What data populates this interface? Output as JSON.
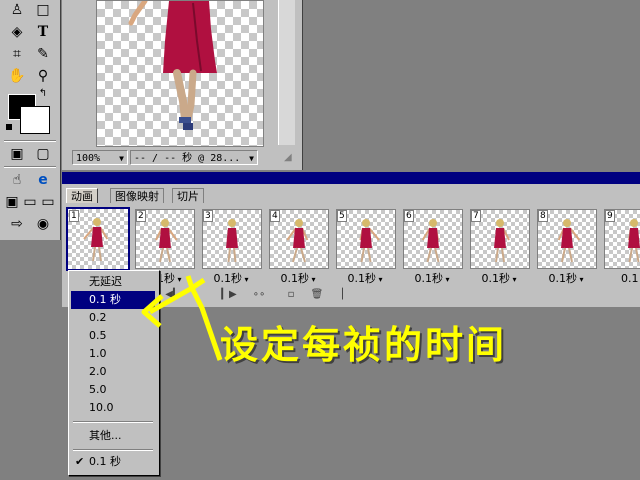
{
  "document": {
    "zoom": "100%",
    "timing_status": "-- / -- 秒 @ 28..."
  },
  "animation_palette": {
    "tabs": [
      "动画",
      "图像映射",
      "切片"
    ],
    "frames": [
      {
        "number": "1",
        "time": ""
      },
      {
        "number": "2",
        "time": "0.1秒"
      },
      {
        "number": "3",
        "time": "0.1秒"
      },
      {
        "number": "4",
        "time": "0.1秒"
      },
      {
        "number": "5",
        "time": "0.1秒"
      },
      {
        "number": "6",
        "time": "0.1秒"
      },
      {
        "number": "7",
        "time": "0.1秒"
      },
      {
        "number": "8",
        "time": "0.1秒"
      },
      {
        "number": "9",
        "time": "0.1"
      }
    ]
  },
  "delay_menu": {
    "items": [
      "无延迟",
      "0.1 秒",
      "0.2",
      "0.5",
      "1.0",
      "2.0",
      "5.0",
      "10.0"
    ],
    "other": "其他...",
    "current": "0.1 秒",
    "checkmark": "✔"
  },
  "annotation": {
    "text": "设定每祯的时间",
    "color": "#ffff00"
  },
  "colors": {
    "selection": "#000080",
    "dress": "#b01040"
  }
}
